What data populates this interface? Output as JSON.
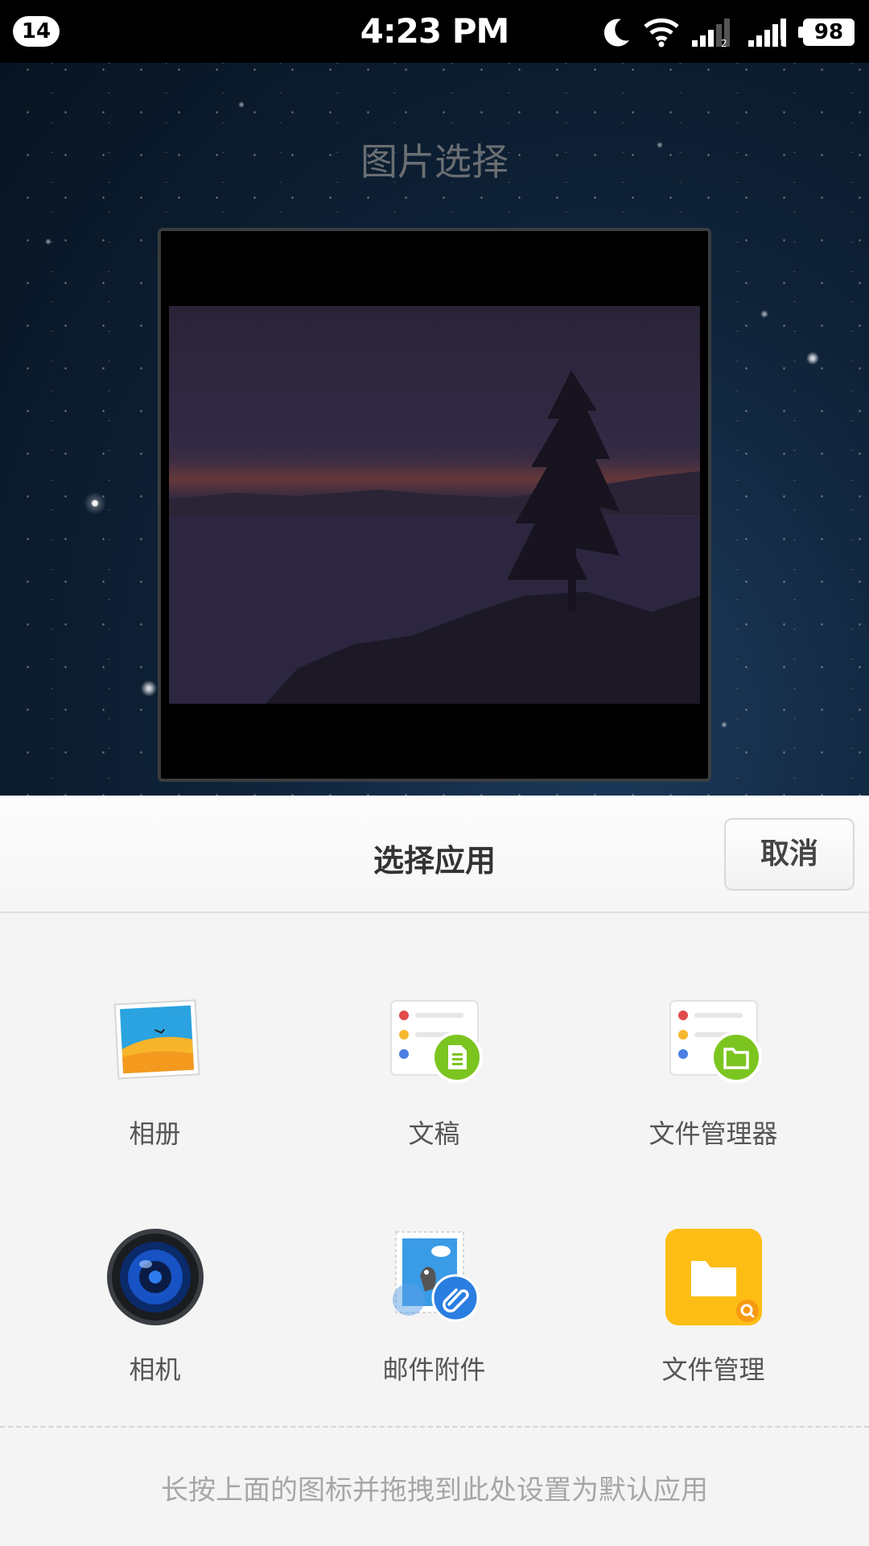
{
  "status_bar": {
    "notification_count": "14",
    "time": "4:23 PM",
    "battery_level": "98",
    "icons": [
      "moon-icon",
      "wifi-icon",
      "signal-sim2-icon",
      "signal-sim1-icon",
      "battery-icon"
    ]
  },
  "picker": {
    "title": "图片选择"
  },
  "sheet": {
    "title": "选择应用",
    "cancel_label": "取消",
    "apps": [
      {
        "label": "相册",
        "icon": "gallery-icon"
      },
      {
        "label": "文稿",
        "icon": "documents-icon"
      },
      {
        "label": "文件管理器",
        "icon": "file-manager-icon"
      },
      {
        "label": "相机",
        "icon": "camera-icon"
      },
      {
        "label": "邮件附件",
        "icon": "mail-attachment-icon"
      },
      {
        "label": "文件管理",
        "icon": "file-management-icon"
      }
    ],
    "hint": "长按上面的图标并拖拽到此处设置为默认应用"
  },
  "colors": {
    "sheet_background": "#f4f4f4",
    "accent_green": "#7cc520",
    "folder_yellow": "#fdbd14"
  }
}
